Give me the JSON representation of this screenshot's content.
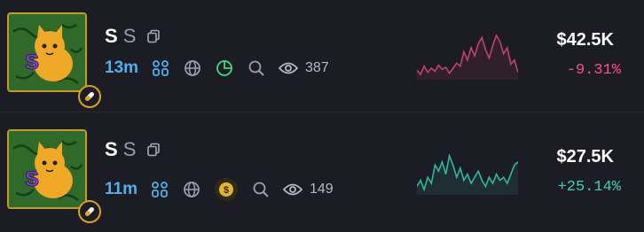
{
  "rows": [
    {
      "symbol": "S",
      "name": "S",
      "age": "13m",
      "views": "387",
      "market_cap": "$42.5K",
      "change": "-9.31%",
      "trend": "down",
      "spark_color": "#c2406f",
      "spark_values": [
        62,
        66,
        58,
        64,
        60,
        63,
        57,
        61,
        59,
        65,
        60,
        55,
        58,
        44,
        52,
        40,
        48,
        36,
        30,
        42,
        50,
        38,
        28,
        34,
        46,
        40,
        56,
        52,
        64
      ],
      "icons": [
        "holders-icon",
        "globe-icon",
        "pie-chart-icon",
        "search-icon",
        "eye-icon"
      ]
    },
    {
      "symbol": "S",
      "name": "S",
      "age": "11m",
      "views": "149",
      "market_cap": "$27.5K",
      "change": "+25.14%",
      "trend": "up",
      "spark_color": "#2fb8a0",
      "spark_values": [
        44,
        40,
        46,
        38,
        42,
        30,
        34,
        28,
        36,
        24,
        30,
        38,
        32,
        40,
        36,
        42,
        38,
        34,
        40,
        44,
        38,
        42,
        36,
        40,
        38,
        42,
        36,
        30,
        28
      ],
      "icons": [
        "holders-icon",
        "globe-icon",
        "coin-icon",
        "search-icon",
        "eye-icon"
      ]
    }
  ],
  "colors": {
    "background": "#1c1c24",
    "accent_blue": "#4fb0ee",
    "negative": "#ff4d8a",
    "positive": "#3fd1b7",
    "gold_border": "#c89a1e",
    "pie_green": "#3ddc84"
  }
}
